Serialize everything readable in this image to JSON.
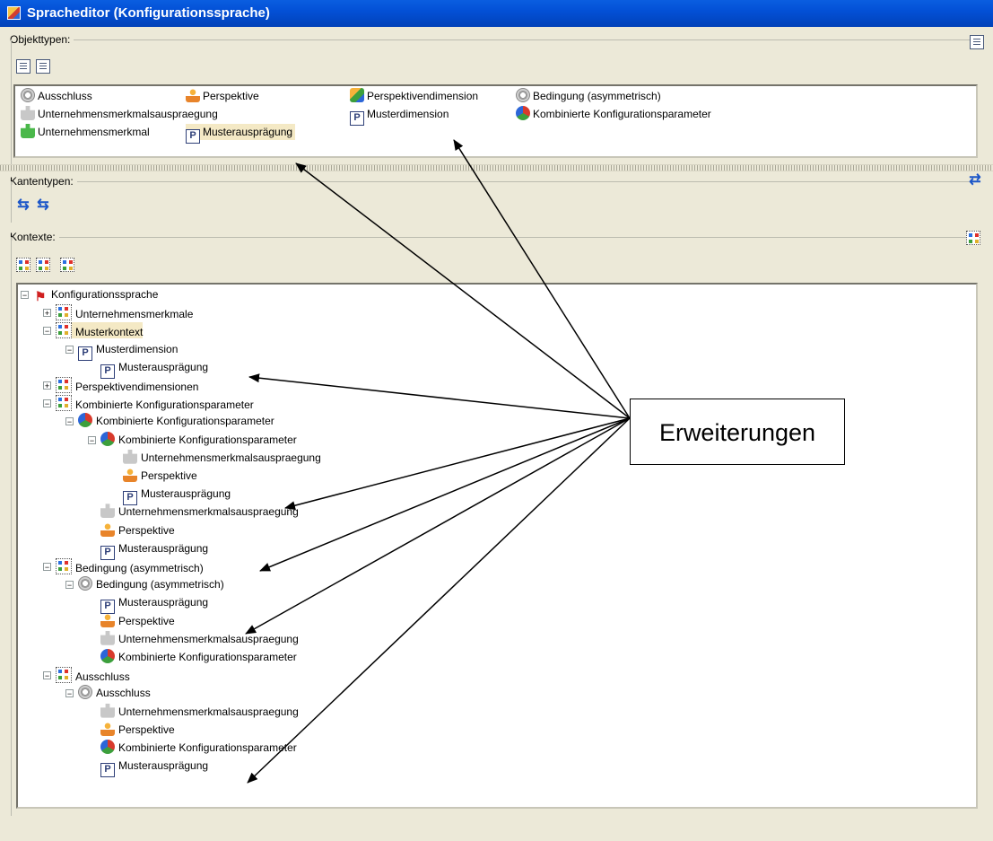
{
  "window": {
    "title": "Spracheditor (Konfigurationssprache)"
  },
  "objekttypen": {
    "label": "Objekttypen:",
    "items": [
      {
        "label": "Ausschluss",
        "icon": "gear-icon"
      },
      {
        "label": "Perspektive",
        "icon": "person-icon"
      },
      {
        "label": "Perspektivendimension",
        "icon": "dimension-icon"
      },
      {
        "label": "Bedingung (asymmetrisch)",
        "icon": "gear-icon"
      },
      {
        "label": "Unternehmensmerkmalsauspraegung",
        "icon": "puzzle-grey-icon"
      },
      {
        "label": "Musterdimension",
        "icon": "pattern-icon"
      },
      {
        "label": "Kombinierte Konfigurationsparameter",
        "icon": "ball-icon"
      },
      {
        "label": "Unternehmensmerkmal",
        "icon": "puzzle-green-icon"
      },
      {
        "label": "Musterausprägung",
        "icon": "pattern-icon"
      }
    ]
  },
  "kantentypen": {
    "label": "Kantentypen:"
  },
  "kontexte": {
    "label": "Kontexte:",
    "tree": [
      {
        "label": "Konfigurationssprache",
        "level": 0,
        "icon": "root-icon",
        "expander": "−"
      },
      {
        "label": "Unternehmensmerkmale",
        "level": 1,
        "icon": "context-icon",
        "expander": "+"
      },
      {
        "label": "Musterkontext",
        "level": 1,
        "icon": "context-icon",
        "expander": "−",
        "selected": true
      },
      {
        "label": "Musterdimension",
        "level": 2,
        "icon": "pattern-icon",
        "expander": "−"
      },
      {
        "label": "Musterausprägung",
        "level": 3,
        "icon": "pattern-icon"
      },
      {
        "label": "Perspektivendimensionen",
        "level": 1,
        "icon": "context-icon",
        "expander": "+"
      },
      {
        "label": "Kombinierte Konfigurationsparameter",
        "level": 1,
        "icon": "context-icon",
        "expander": "−"
      },
      {
        "label": "Kombinierte Konfigurationsparameter",
        "level": 2,
        "icon": "ball-icon",
        "expander": "−"
      },
      {
        "label": "Kombinierte Konfigurationsparameter",
        "level": 3,
        "icon": "ball-icon",
        "expander": "−"
      },
      {
        "label": "Unternehmensmerkmalsauspraegung",
        "level": 4,
        "icon": "puzzle-grey-icon"
      },
      {
        "label": "Perspektive",
        "level": 4,
        "icon": "person-icon"
      },
      {
        "label": "Musterausprägung",
        "level": 4,
        "icon": "pattern-icon"
      },
      {
        "label": "Unternehmensmerkmalsauspraegung",
        "level": 3,
        "icon": "puzzle-grey-icon"
      },
      {
        "label": "Perspektive",
        "level": 3,
        "icon": "person-icon"
      },
      {
        "label": "Musterausprägung",
        "level": 3,
        "icon": "pattern-icon"
      },
      {
        "label": "Bedingung (asymmetrisch)",
        "level": 1,
        "icon": "context-icon",
        "expander": "−"
      },
      {
        "label": "Bedingung (asymmetrisch)",
        "level": 2,
        "icon": "gear-icon",
        "expander": "−"
      },
      {
        "label": "Musterausprägung",
        "level": 3,
        "icon": "pattern-icon"
      },
      {
        "label": "Perspektive",
        "level": 3,
        "icon": "person-icon"
      },
      {
        "label": "Unternehmensmerkmalsauspraegung",
        "level": 3,
        "icon": "puzzle-grey-icon"
      },
      {
        "label": "Kombinierte Konfigurationsparameter",
        "level": 3,
        "icon": "ball-icon"
      },
      {
        "label": "Ausschluss",
        "level": 1,
        "icon": "context-icon",
        "expander": "−"
      },
      {
        "label": "Ausschluss",
        "level": 2,
        "icon": "gear-icon",
        "expander": "−"
      },
      {
        "label": "Unternehmensmerkmalsauspraegung",
        "level": 3,
        "icon": "puzzle-grey-icon"
      },
      {
        "label": "Perspektive",
        "level": 3,
        "icon": "person-icon"
      },
      {
        "label": "Kombinierte Konfigurationsparameter",
        "level": 3,
        "icon": "ball-icon"
      },
      {
        "label": "Musterausprägung",
        "level": 3,
        "icon": "pattern-icon"
      }
    ]
  },
  "callout": {
    "label": "Erweiterungen"
  }
}
